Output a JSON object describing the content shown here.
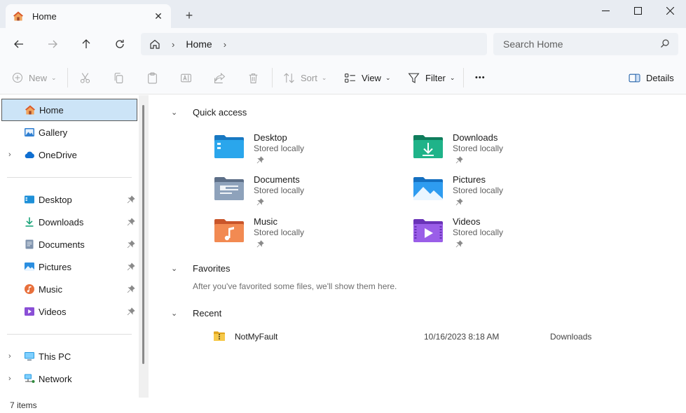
{
  "window": {
    "tab_title": "Home",
    "tab_icon": "home-icon",
    "controls": [
      "minimize-icon",
      "maximize-icon",
      "close-icon"
    ]
  },
  "address": {
    "path": "Home",
    "search_placeholder": "Search Home"
  },
  "toolbar": {
    "new_label": "New",
    "sort_label": "Sort",
    "view_label": "View",
    "filter_label": "Filter",
    "more_label": "•••",
    "details_label": "Details"
  },
  "sidebar": {
    "items": [
      {
        "label": "Home",
        "icon": "home-icon",
        "selected": true
      },
      {
        "label": "Gallery",
        "icon": "gallery-icon"
      },
      {
        "label": "OneDrive",
        "icon": "cloud-icon",
        "expandable": true
      },
      {
        "label": "Desktop",
        "icon": "desktop-icon",
        "pinned": true
      },
      {
        "label": "Downloads",
        "icon": "download-icon",
        "pinned": true
      },
      {
        "label": "Documents",
        "icon": "document-icon",
        "pinned": true
      },
      {
        "label": "Pictures",
        "icon": "picture-icon",
        "pinned": true
      },
      {
        "label": "Music",
        "icon": "music-icon",
        "pinned": true
      },
      {
        "label": "Videos",
        "icon": "video-icon",
        "pinned": true
      },
      {
        "label": "This PC",
        "icon": "computer-icon",
        "expandable": true
      },
      {
        "label": "Network",
        "icon": "network-icon",
        "expandable": true
      }
    ]
  },
  "main": {
    "quick_access": {
      "title": "Quick access",
      "items": [
        {
          "name": "Desktop",
          "sub": "Stored locally",
          "color": "#1e90d8"
        },
        {
          "name": "Downloads",
          "sub": "Stored locally",
          "color": "#1aa37a"
        },
        {
          "name": "Documents",
          "sub": "Stored locally",
          "color": "#7f93ad"
        },
        {
          "name": "Pictures",
          "sub": "Stored locally",
          "color": "#2a8ee0"
        },
        {
          "name": "Music",
          "sub": "Stored locally",
          "color": "#e8703c"
        },
        {
          "name": "Videos",
          "sub": "Stored locally",
          "color": "#8a4fd6"
        }
      ]
    },
    "favorites": {
      "title": "Favorites",
      "empty_text": "After you've favorited some files, we'll show them here."
    },
    "recent": {
      "title": "Recent",
      "rows": [
        {
          "name": "NotMyFault",
          "date": "10/16/2023 8:18 AM",
          "location": "Downloads"
        }
      ]
    }
  },
  "status": {
    "text": "7 items"
  }
}
